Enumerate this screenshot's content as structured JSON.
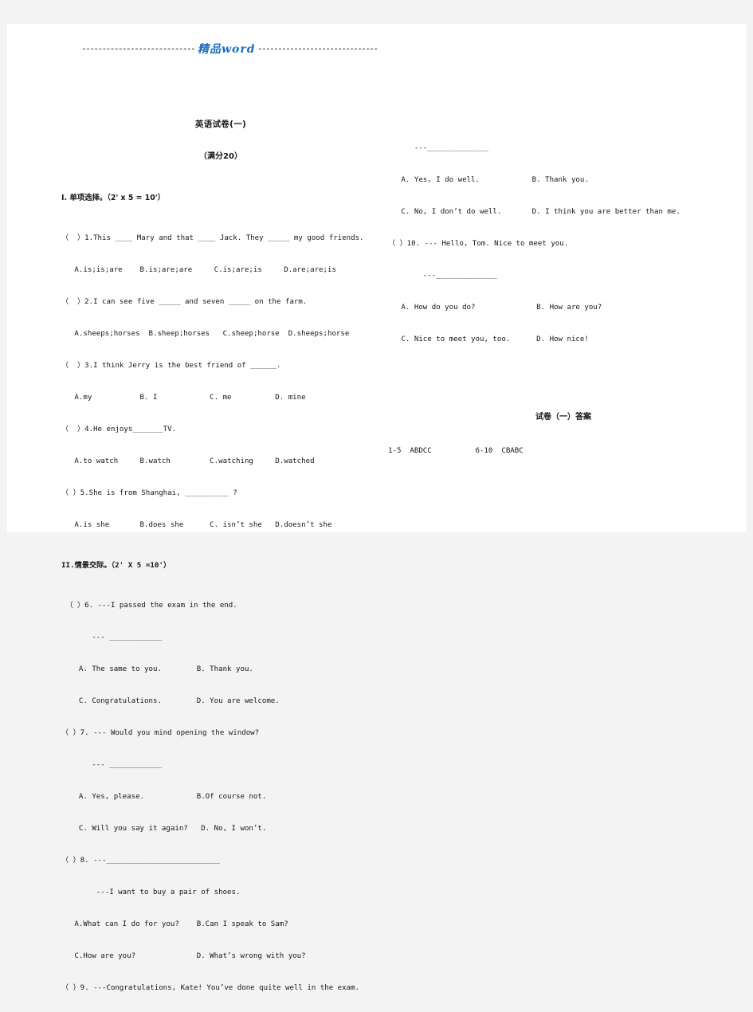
{
  "watermark": {
    "text": "精品word",
    "color": "#1f6fc0",
    "left_rule": "dashed-rule-left",
    "right_rule": "dashed-rule-right"
  },
  "document": {
    "title": "英语试卷(一)",
    "subtitle": "（满分20）",
    "answer_title": "试卷（一）答案"
  },
  "sections": {
    "one_heading": "I. 单项选择。（2' x 5 = 10'）",
    "two_heading": "II.情景交际。（2' X 5 =10'）"
  },
  "left_column": [
    "（  ）1.This ____ Mary and that ____ Jack. They _____ my good friends.",
    "   A.is;is;are    B.is;are;are     C.is;are;is     D.are;are;is",
    "（  ）2.I can see five _____ and seven _____ on the farm.",
    "   A.sheeps;horses  B.sheep;horses   C.sheep;horse  D.sheeps;horse",
    "（  ）3.I think Jerry is the best friend of ______.",
    "   A.my           B. I            C. me          D. mine",
    "（  ）4.He enjoys_______TV.",
    "   A.to watch     B.watch         C.watching     D.watched",
    "（ ）5.She is from Shanghai, __________ ?",
    "   A.is she       B.does she      C. isn’t she   D.doesn’t she"
  ],
  "left_column_2": [
    " （ ）6. ---I passed the exam in the end.",
    "       --- ____________",
    "    A. The same to you.        B. Thank you.",
    "    C. Congratulations.        D. You are welcome.",
    "（ ）7. --- Would you mind opening the window?",
    "       --- ____________",
    "    A. Yes, please.            B.Of course not.",
    "    C. Will you say it again?   D. No, I won’t.",
    "（ ）8. ---__________________________",
    "        ---I want to buy a pair of shoes.",
    "   A.What can I do for you?    B.Can I speak to Sam?",
    "   C.How are you?              D. What’s wrong with you?",
    "（ ）9. ---Congratulations, Kate! You’ve done quite well in the exam."
  ],
  "right_column": [
    "      ---______________",
    "   A. Yes, I do well.            B. Thank you.",
    "   C. No, I don’t do well.       D. I think you are better than me.",
    "（ ）10. --- Hello, Tom. Nice to meet you.",
    "        ---______________",
    "   A. How do you do?              B. How are you?",
    "   C. Nice to meet you, too.      D. How nice!"
  ],
  "answers": {
    "line": "1-5  ABDCC          6-10  CBABC"
  }
}
